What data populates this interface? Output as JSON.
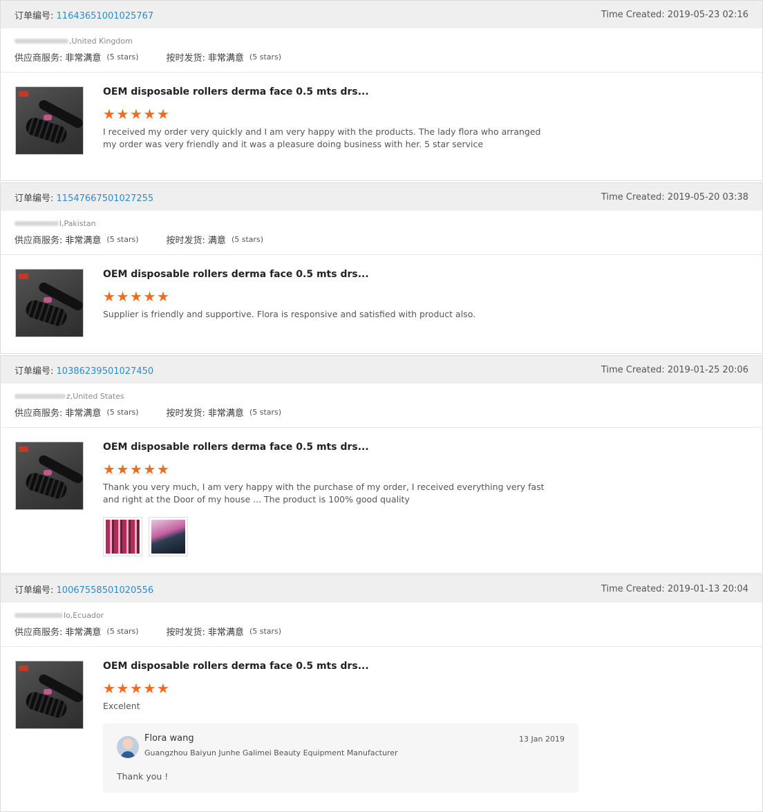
{
  "order_label": "订单编号:",
  "time_label": "Time Created:",
  "supplier_service_label": "供应商服务:",
  "on_time_label": "按时发货:",
  "reviews": [
    {
      "order_number": "11643651001025767",
      "time_created": "2019-05-23 02:16",
      "buyer_country": ",United Kingdom",
      "supplier_service_value": "非常满意",
      "supplier_service_stars": "(5 stars)",
      "on_time_value": "非常满意",
      "on_time_stars": "(5 stars)",
      "product_title": "OEM disposable rollers derma face 0.5 mts drs...",
      "rating": 5,
      "comment": "I received my order very quickly and I am very happy with the products. The lady flora who arranged my order was very friendly and it was a pleasure doing business with her. 5 star service"
    },
    {
      "order_number": "11547667501027255",
      "time_created": "2019-05-20 03:38",
      "buyer_country": "l,Pakistan",
      "supplier_service_value": "非常满意",
      "supplier_service_stars": "(5 stars)",
      "on_time_value": "满意",
      "on_time_stars": "(5 stars)",
      "product_title": "OEM disposable rollers derma face 0.5 mts drs...",
      "rating": 5,
      "comment": "Supplier is friendly and supportive. Flora is responsive and satisfied with product also."
    },
    {
      "order_number": "10386239501027450",
      "time_created": "2019-01-25 20:06",
      "buyer_country": "z,United States",
      "supplier_service_value": "非常满意",
      "supplier_service_stars": "(5 stars)",
      "on_time_value": "非常满意",
      "on_time_stars": "(5 stars)",
      "product_title": "OEM disposable rollers derma face 0.5 mts drs...",
      "rating": 5,
      "comment": "Thank you very much, I am very happy with the purchase of my order, I received everything very fast and right at the Door of my house ... The product is 100% good quality"
    },
    {
      "order_number": "10067558501020556",
      "time_created": "2019-01-13 20:04",
      "buyer_country": "lo,Ecuador",
      "supplier_service_value": "非常满意",
      "supplier_service_stars": "(5 stars)",
      "on_time_value": "非常满意",
      "on_time_stars": "(5 stars)",
      "product_title": "OEM disposable rollers derma face 0.5 mts drs...",
      "rating": 5,
      "comment": "Excelent",
      "reply": {
        "name": "Flora wang",
        "company": "Guangzhou Baiyun Junhe Galimei Beauty Equipment Manufacturer",
        "date": "13 Jan 2019",
        "text": "Thank you !"
      }
    }
  ],
  "colors": {
    "link": "#2a8bd0",
    "star": "#f26b1d",
    "header_bg": "#efefef"
  },
  "icons": {
    "star": "star-icon"
  }
}
